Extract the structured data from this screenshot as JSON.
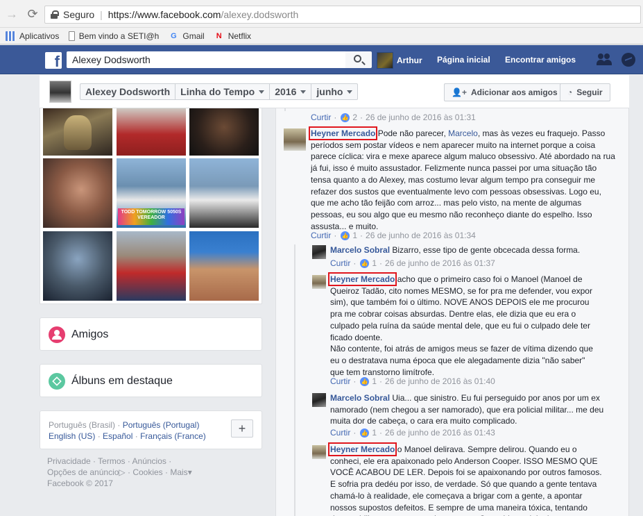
{
  "browser": {
    "secure_label": "Seguro",
    "url_main": "https://www.facebook.com",
    "url_path": "/alexey.dodsworth",
    "bookmarks": [
      "Aplicativos",
      "Bem vindo a SETI@h",
      "Gmail",
      "Netflix"
    ]
  },
  "fb_header": {
    "search_value": "Alexey Dodsworth",
    "user_name": "Arthur",
    "home_label": "Página inicial",
    "find_friends_label": "Encontrar amigos"
  },
  "timeline": {
    "crumbs": [
      "Alexey Dodsworth",
      "Linha do Tempo",
      "2016",
      "junho"
    ],
    "add_friend_label": "Adicionar aos amigos",
    "follow_label": "Seguir"
  },
  "sidebar": {
    "photo_caption": "TODD TOMORROW 5050S VEREADOR",
    "friends_label": "Amigos",
    "albums_label": "Álbuns em destaque",
    "languages": [
      "Português (Brasil)",
      "Português (Portugal)",
      "English (US)",
      "Español",
      "Français (France)"
    ],
    "footer_line1": [
      "Privacidade",
      "Termos",
      "Anúncios"
    ],
    "footer_line2": [
      "Opções de anúncio",
      "Cookies",
      "Mais"
    ],
    "copyright": "Facebook © 2017"
  },
  "comments": {
    "like_action": "Curtir",
    "items": [
      {
        "meta": {
          "likes": "2",
          "time": "26 de junho de 2016 às 01:31"
        }
      },
      {
        "author": "Heyner Mercado",
        "text_before": " Pode não parecer, ",
        "mention": "Marcelo",
        "text_after": ", mas às vezes eu fraquejo. Passo períodos sem postar vídeos e nem aparecer muito na internet porque a coisa parece cíclica: vira e mexe aparece algum maluco obsessivo. Até abordado na rua já fui, isso é muito assustador. Felizmente nunca passei por uma situação tão tensa quanto a do Alexey, mas costumo levar algum tempo pra conseguir me refazer dos sustos que eventualmente levo com pessoas obsessivas. Logo eu, que me acho tão feijão com arroz... mas pelo visto, na mente de algumas pessoas, eu sou algo que eu mesmo não reconheço diante do espelho. Isso assusta... e muito.",
        "likes": "1",
        "time": "26 de junho de 2016 às 01:34"
      },
      {
        "author": "Marcelo Sobral",
        "text": " Bizarro, esse tipo de gente obcecada dessa forma.",
        "likes": "1",
        "time": "26 de junho de 2016 às 01:37"
      },
      {
        "author": "Heyner Mercado",
        "text": " acho que o primeiro caso foi o Manoel (Manoel de Queiroz Tadão, cito nomes MESMO, se for pra me defender, vou expor sim), que também foi o último. NOVE ANOS DEPOIS ele me procurou pra me cobrar coisas absurdas. Dentre elas, ele dizia que eu era o culpado pela ruína da saúde mental dele, que eu fui o culpado dele ter ficado doente.",
        "text2": "Não contente, foi atrás de amigos meus se fazer de vítima dizendo que eu o destratava numa época que ele alegadamente dizia \"não saber\" que tem transtorno limítrofe.",
        "likes": "1",
        "time": "26 de junho de 2016 às 01:40"
      },
      {
        "author": "Marcelo Sobral",
        "text": " Uia... que sinistro. Eu fui perseguido por anos por um ex namorado (nem chegou a ser namorado), que era policial militar... me deu muita dor de cabeça, o cara era muito complicado.",
        "likes": "1",
        "time": "26 de junho de 2016 às 01:43"
      },
      {
        "author": "Heyner Mercado",
        "text": " o Manoel delirava. Sempre delirou. Quando eu o conheci, ele era apaixonado pelo Anderson Cooper. ISSO MESMO QUE VOCÊ ACABOU DE LER. Depois foi se apaixonando por outros famosos. E sofria pra dedéu por isso, de verdade. Só que quando a gente tentava chamá-lo à realidade, ele começava a brigar com a gente, a apontar nossos supostos defeitos. E sempre de uma maneira tóxica, tentando desestabilizar a gente a qualquer custo. Sem vida social, ele"
      }
    ]
  }
}
